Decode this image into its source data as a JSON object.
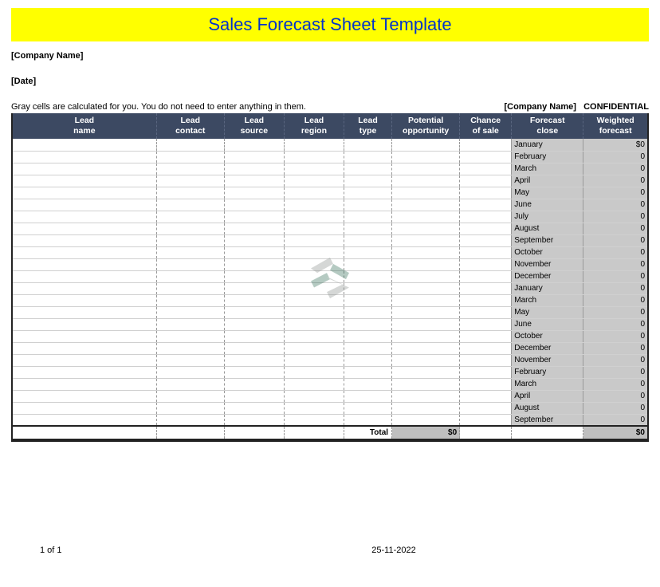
{
  "title": "Sales Forecast Sheet Template",
  "company_name": "[Company Name]",
  "date_label": "[Date]",
  "note": "Gray cells are calculated for you. You do not need to enter anything in them.",
  "confidential_company": "[Company Name]",
  "confidential_label": "CONFIDENTIAL",
  "columns": {
    "lead_name": [
      "Lead",
      "name"
    ],
    "lead_contact": [
      "Lead",
      "contact"
    ],
    "lead_source": [
      "Lead",
      "source"
    ],
    "lead_region": [
      "Lead",
      "region"
    ],
    "lead_type": [
      "Lead",
      "type"
    ],
    "potential_opp": [
      "Potential",
      "opportunity"
    ],
    "chance_sale": [
      "Chance",
      "of sale"
    ],
    "forecast_close": [
      "Forecast",
      "close"
    ],
    "weighted_forecast": [
      "Weighted",
      "forecast"
    ]
  },
  "rows": [
    {
      "forecast_close": "January",
      "weighted": "$0"
    },
    {
      "forecast_close": "February",
      "weighted": "0"
    },
    {
      "forecast_close": "March",
      "weighted": "0"
    },
    {
      "forecast_close": "April",
      "weighted": "0"
    },
    {
      "forecast_close": "May",
      "weighted": "0"
    },
    {
      "forecast_close": "June",
      "weighted": "0"
    },
    {
      "forecast_close": "July",
      "weighted": "0"
    },
    {
      "forecast_close": "August",
      "weighted": "0"
    },
    {
      "forecast_close": "September",
      "weighted": "0"
    },
    {
      "forecast_close": "October",
      "weighted": "0"
    },
    {
      "forecast_close": "November",
      "weighted": "0"
    },
    {
      "forecast_close": "December",
      "weighted": "0"
    },
    {
      "forecast_close": "January",
      "weighted": "0"
    },
    {
      "forecast_close": "March",
      "weighted": "0"
    },
    {
      "forecast_close": "May",
      "weighted": "0"
    },
    {
      "forecast_close": "June",
      "weighted": "0"
    },
    {
      "forecast_close": "October",
      "weighted": "0"
    },
    {
      "forecast_close": "December",
      "weighted": "0"
    },
    {
      "forecast_close": "November",
      "weighted": "0"
    },
    {
      "forecast_close": "February",
      "weighted": "0"
    },
    {
      "forecast_close": "March",
      "weighted": "0"
    },
    {
      "forecast_close": "April",
      "weighted": "0"
    },
    {
      "forecast_close": "August",
      "weighted": "0"
    },
    {
      "forecast_close": "September",
      "weighted": "0"
    }
  ],
  "totals": {
    "label": "Total",
    "potential": "$0",
    "weighted": "$0"
  },
  "footer": {
    "page": "1 of 1",
    "date": "25-11-2022"
  }
}
